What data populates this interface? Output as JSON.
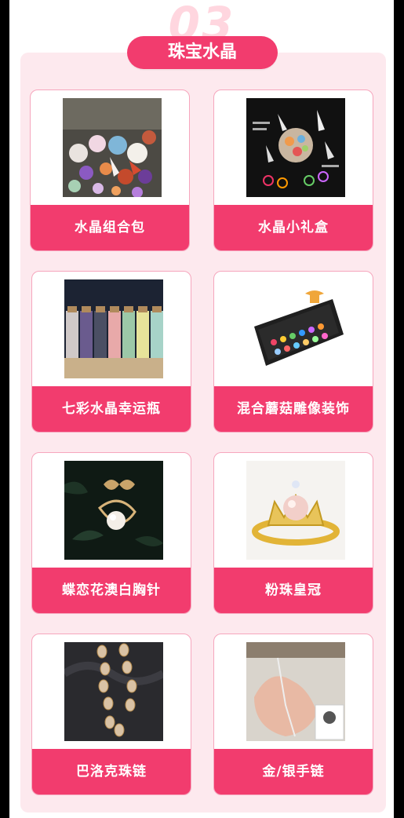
{
  "section": {
    "number": "03",
    "title": "珠宝水晶"
  },
  "products": [
    {
      "label": "水晶组合包"
    },
    {
      "label": "水晶小礼盒"
    },
    {
      "label": "七彩水晶幸运瓶"
    },
    {
      "label": "混合蘑菇雕像装饰"
    },
    {
      "label": "蝶恋花澳白胸针"
    },
    {
      "label": "粉珠皇冠"
    },
    {
      "label": "巴洛克珠链"
    },
    {
      "label": "金/银手链"
    }
  ],
  "colors": {
    "accent": "#f23c6e",
    "panel": "#fde9ee",
    "number": "#ffd6df"
  }
}
